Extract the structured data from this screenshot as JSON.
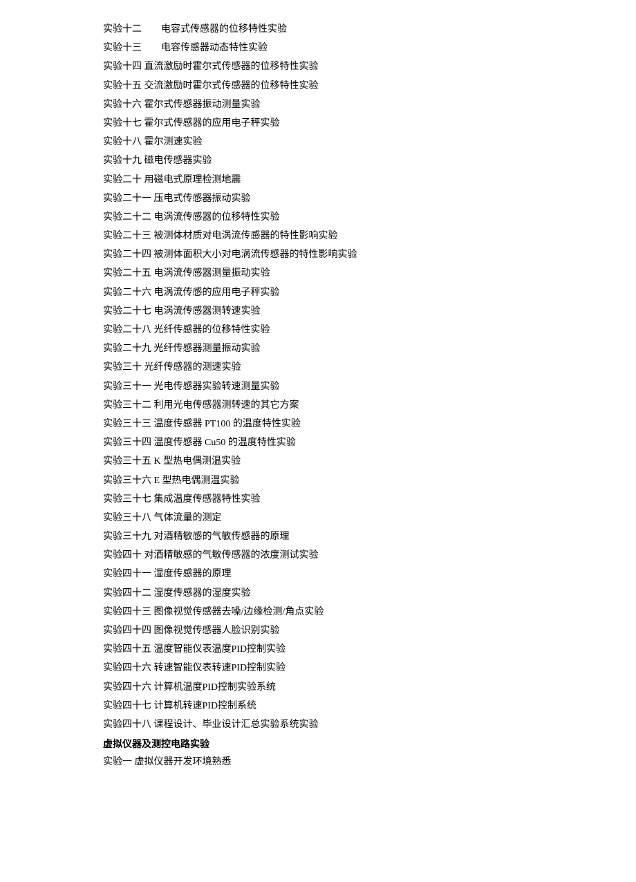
{
  "lines": [
    "实验十二　　电容式传感器的位移特性实验",
    "实验十三　　电容传感器动态特性实验",
    "实验十四  直流激励时霍尔式传感器的位移特性实验",
    "实验十五  交流激励时霍尔式传感器的位移特性实验",
    "实验十六  霍尔式传感器振动测量实验",
    "实验十七  霍尔式传感器的应用电子秤实验",
    "实验十八  霍尔测速实验",
    "实验十九  磁电传感器实验",
    "实验二十  用磁电式原理检测地震",
    "实验二十一  压电式传感器振动实验",
    "实验二十二  电涡流传感器的位移特性实验",
    "实验二十三  被测体材质对电涡流传感器的特性影响实验",
    "实验二十四  被测体面积大小对电涡流传感器的特性影响实验",
    "实验二十五  电涡流传感器测量振动实验",
    "实验二十六  电涡流传感的应用电子秤实验",
    "实验二十七  电涡流传感器测转速实验",
    "实验二十八  光纤传感器的位移特性实验",
    "实验二十九  光纤传感器测量振动实验",
    "实验三十  光纤传感器的测速实验",
    "实验三十一  光电传感器实验转速测量实验",
    "实验三十二  利用光电传感器测转速的其它方案",
    "实验三十三  温度传感器 PT100 的温度特性实验",
    "实验三十四  温度传感器 Cu50 的温度特性实验",
    "实验三十五  K 型热电偶测温实验",
    "实验三十六  E 型热电偶测温实验",
    "实验三十七  集成温度传感器特性实验",
    "实验三十八  气体流量的测定",
    "实验三十九  对酒精敏感的气敏传感器的原理",
    "实验四十  对酒精敏感的气敏传感器的浓度测试实验",
    "实验四十一  湿度传感器的原理",
    "实验四十二  湿度传感器的湿度实验",
    "实验四十三  图像视觉传感器去噪/边缘检测/角点实验",
    "实验四十四  图像视觉传感器人脸识别实验",
    "实验四十五  温度智能仪表温度PID控制实验",
    "实验四十六  转速智能仪表转速PID控制实验",
    "实验四十六  计算机温度PID控制实验系统",
    "实验四十七  计算机转速PID控制系统",
    "实验四十八  课程设计、毕业设计汇总实验系统实验"
  ],
  "section_heading": "虚拟仪器及测控电路实验",
  "last_line": "实验一  虚拟仪器开发环境熟悉"
}
